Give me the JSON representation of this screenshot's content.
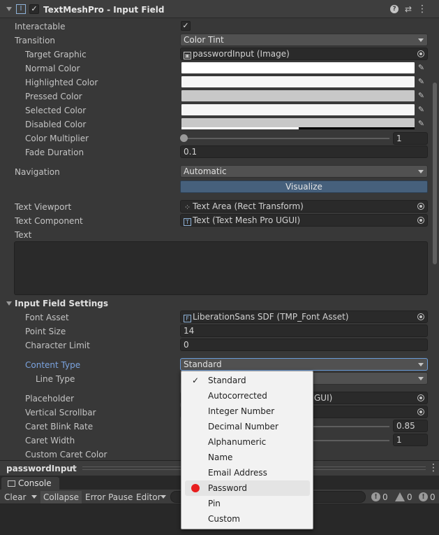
{
  "component": {
    "title": "TextMeshPro - Input Field"
  },
  "properties": {
    "interactable": "Interactable",
    "transition": "Transition",
    "transition_value": "Color Tint",
    "target_graphic": "Target Graphic",
    "target_graphic_value": "passwordInput (Image)",
    "normal_color": "Normal Color",
    "highlighted_color": "Highlighted Color",
    "pressed_color": "Pressed Color",
    "selected_color": "Selected Color",
    "disabled_color": "Disabled Color",
    "color_multiplier": "Color Multiplier",
    "color_multiplier_value": "1",
    "fade_duration": "Fade Duration",
    "fade_duration_value": "0.1",
    "navigation": "Navigation",
    "navigation_value": "Automatic",
    "visualize": "Visualize",
    "text_viewport": "Text Viewport",
    "text_viewport_value": "Text Area (Rect Transform)",
    "text_component": "Text Component",
    "text_component_value": "Text (Text Mesh Pro UGUI)",
    "text": "Text"
  },
  "settings": {
    "header": "Input Field Settings",
    "font_asset": "Font Asset",
    "font_asset_value": "LiberationSans SDF (TMP_Font Asset)",
    "point_size": "Point Size",
    "point_size_value": "14",
    "character_limit": "Character Limit",
    "character_limit_value": "0",
    "content_type": "Content Type",
    "content_type_value": "Standard",
    "line_type": "Line Type",
    "placeholder": "Placeholder",
    "placeholder_partial": "GUI)",
    "vertical_scrollbar": "Vertical Scrollbar",
    "caret_blink_rate": "Caret Blink Rate",
    "caret_blink_rate_value": "0.85",
    "caret_width": "Caret Width",
    "caret_width_value": "1",
    "custom_caret_color": "Custom Caret Color"
  },
  "dropdown_menu": {
    "items": [
      "Standard",
      "Autocorrected",
      "Integer Number",
      "Decimal Number",
      "Alphanumeric",
      "Name",
      "Email Address",
      "Password",
      "Pin",
      "Custom"
    ],
    "checked": "Standard",
    "highlighted": "Password"
  },
  "footer": {
    "object_name": "passwordInput"
  },
  "console": {
    "tab": "Console",
    "clear": "Clear",
    "collapse": "Collapse",
    "error_pause": "Error Pause",
    "editor": "Editor",
    "info_count": "0",
    "warn_count": "0",
    "error_count": "0"
  },
  "colors": {
    "panel_bg": "#383838",
    "accent_blue": "#8fb3d9",
    "record_red": "#e81e1e",
    "visualize_bg": "#46607c"
  }
}
